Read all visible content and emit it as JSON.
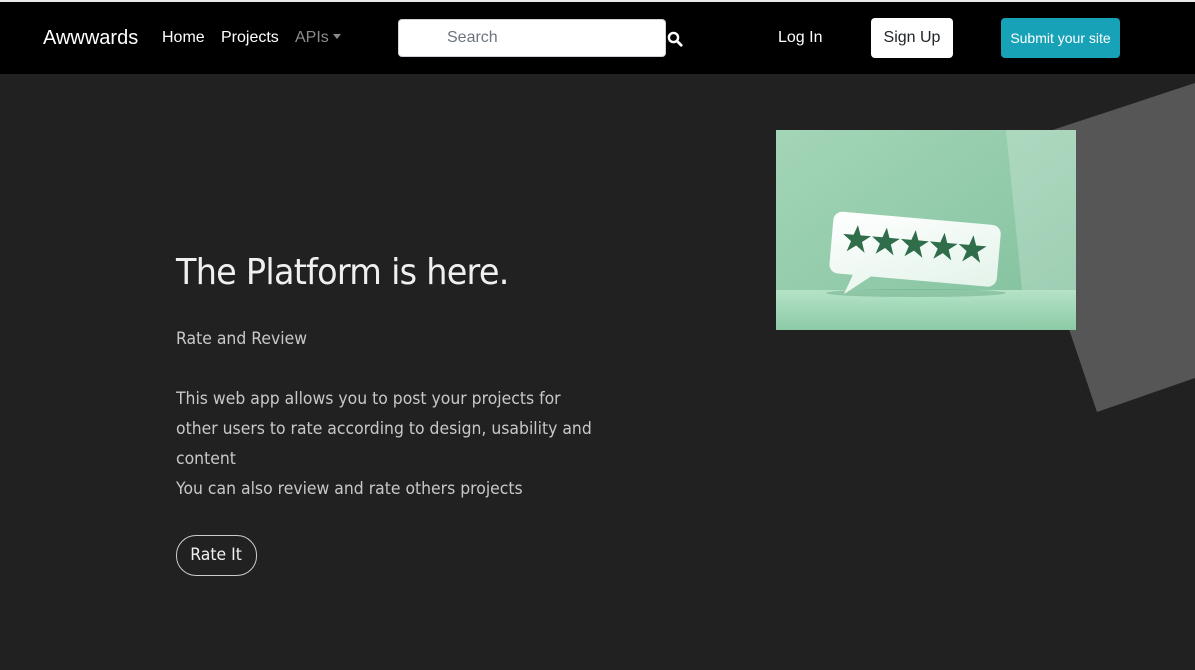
{
  "navbar": {
    "brand": "Awwwards",
    "links": [
      {
        "label": "Home"
      },
      {
        "label": "Projects"
      },
      {
        "label": "APIs"
      }
    ],
    "search": {
      "placeholder": "Search",
      "value": ""
    },
    "login_label": "Log In",
    "signup_label": "Sign Up",
    "submit_label": "Submit your site"
  },
  "hero": {
    "title": "The Platform is here.",
    "subtitle": "Rate and Review",
    "description": "This web app allows you to post your projects for other users to rate according to design, usability and content",
    "note": "You can also review and rate others projects",
    "button_label": "Rate It",
    "image": {
      "icon": "rating-speech-bubble-illustration",
      "stars": 5
    }
  },
  "colors": {
    "background": "#212121",
    "navbar": "#000000",
    "accent": "#17a2b8",
    "image_green": "#8fc9a8",
    "star": "#2f6d4b"
  }
}
